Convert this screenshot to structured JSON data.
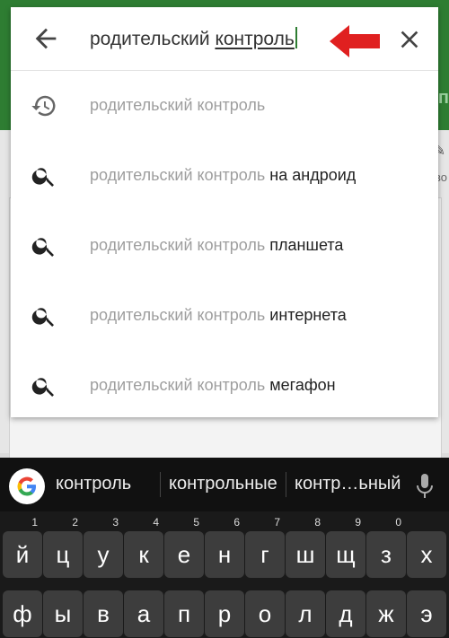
{
  "background": {
    "edge_text": "ıп",
    "edge_small": "во"
  },
  "search": {
    "query_prefix": "родительский ",
    "query_word": "контроль"
  },
  "suggestions": [
    {
      "type": "history",
      "icon": "history-icon",
      "prefix": "родительский контроль",
      "suffix": ""
    },
    {
      "type": "search",
      "icon": "search-icon",
      "prefix": "родительский контроль ",
      "suffix": "на андроид"
    },
    {
      "type": "search",
      "icon": "search-icon",
      "prefix": "родительский контроль ",
      "suffix": "планшета"
    },
    {
      "type": "search",
      "icon": "search-icon",
      "prefix": "родительский контроль ",
      "suffix": "интернета"
    },
    {
      "type": "search",
      "icon": "search-icon",
      "prefix": "родительский контроль ",
      "suffix": "мегафон"
    }
  ],
  "keyboard": {
    "candidates": [
      "контроль",
      "контрольные",
      "контр…ьный"
    ],
    "row1": [
      {
        "k": "й",
        "n": "1"
      },
      {
        "k": "ц",
        "n": "2"
      },
      {
        "k": "у",
        "n": "3"
      },
      {
        "k": "к",
        "n": "4"
      },
      {
        "k": "е",
        "n": "5"
      },
      {
        "k": "н",
        "n": "6"
      },
      {
        "k": "г",
        "n": "7"
      },
      {
        "k": "ш",
        "n": "8"
      },
      {
        "k": "щ",
        "n": "9"
      },
      {
        "k": "з",
        "n": "0"
      },
      {
        "k": "х",
        "n": ""
      }
    ],
    "row2": [
      "ф",
      "ы",
      "в",
      "а",
      "п",
      "р",
      "о",
      "л",
      "д",
      "ж",
      "э"
    ]
  },
  "colors": {
    "accent_green": "#2e7d32",
    "arrow_red": "#e02020"
  }
}
